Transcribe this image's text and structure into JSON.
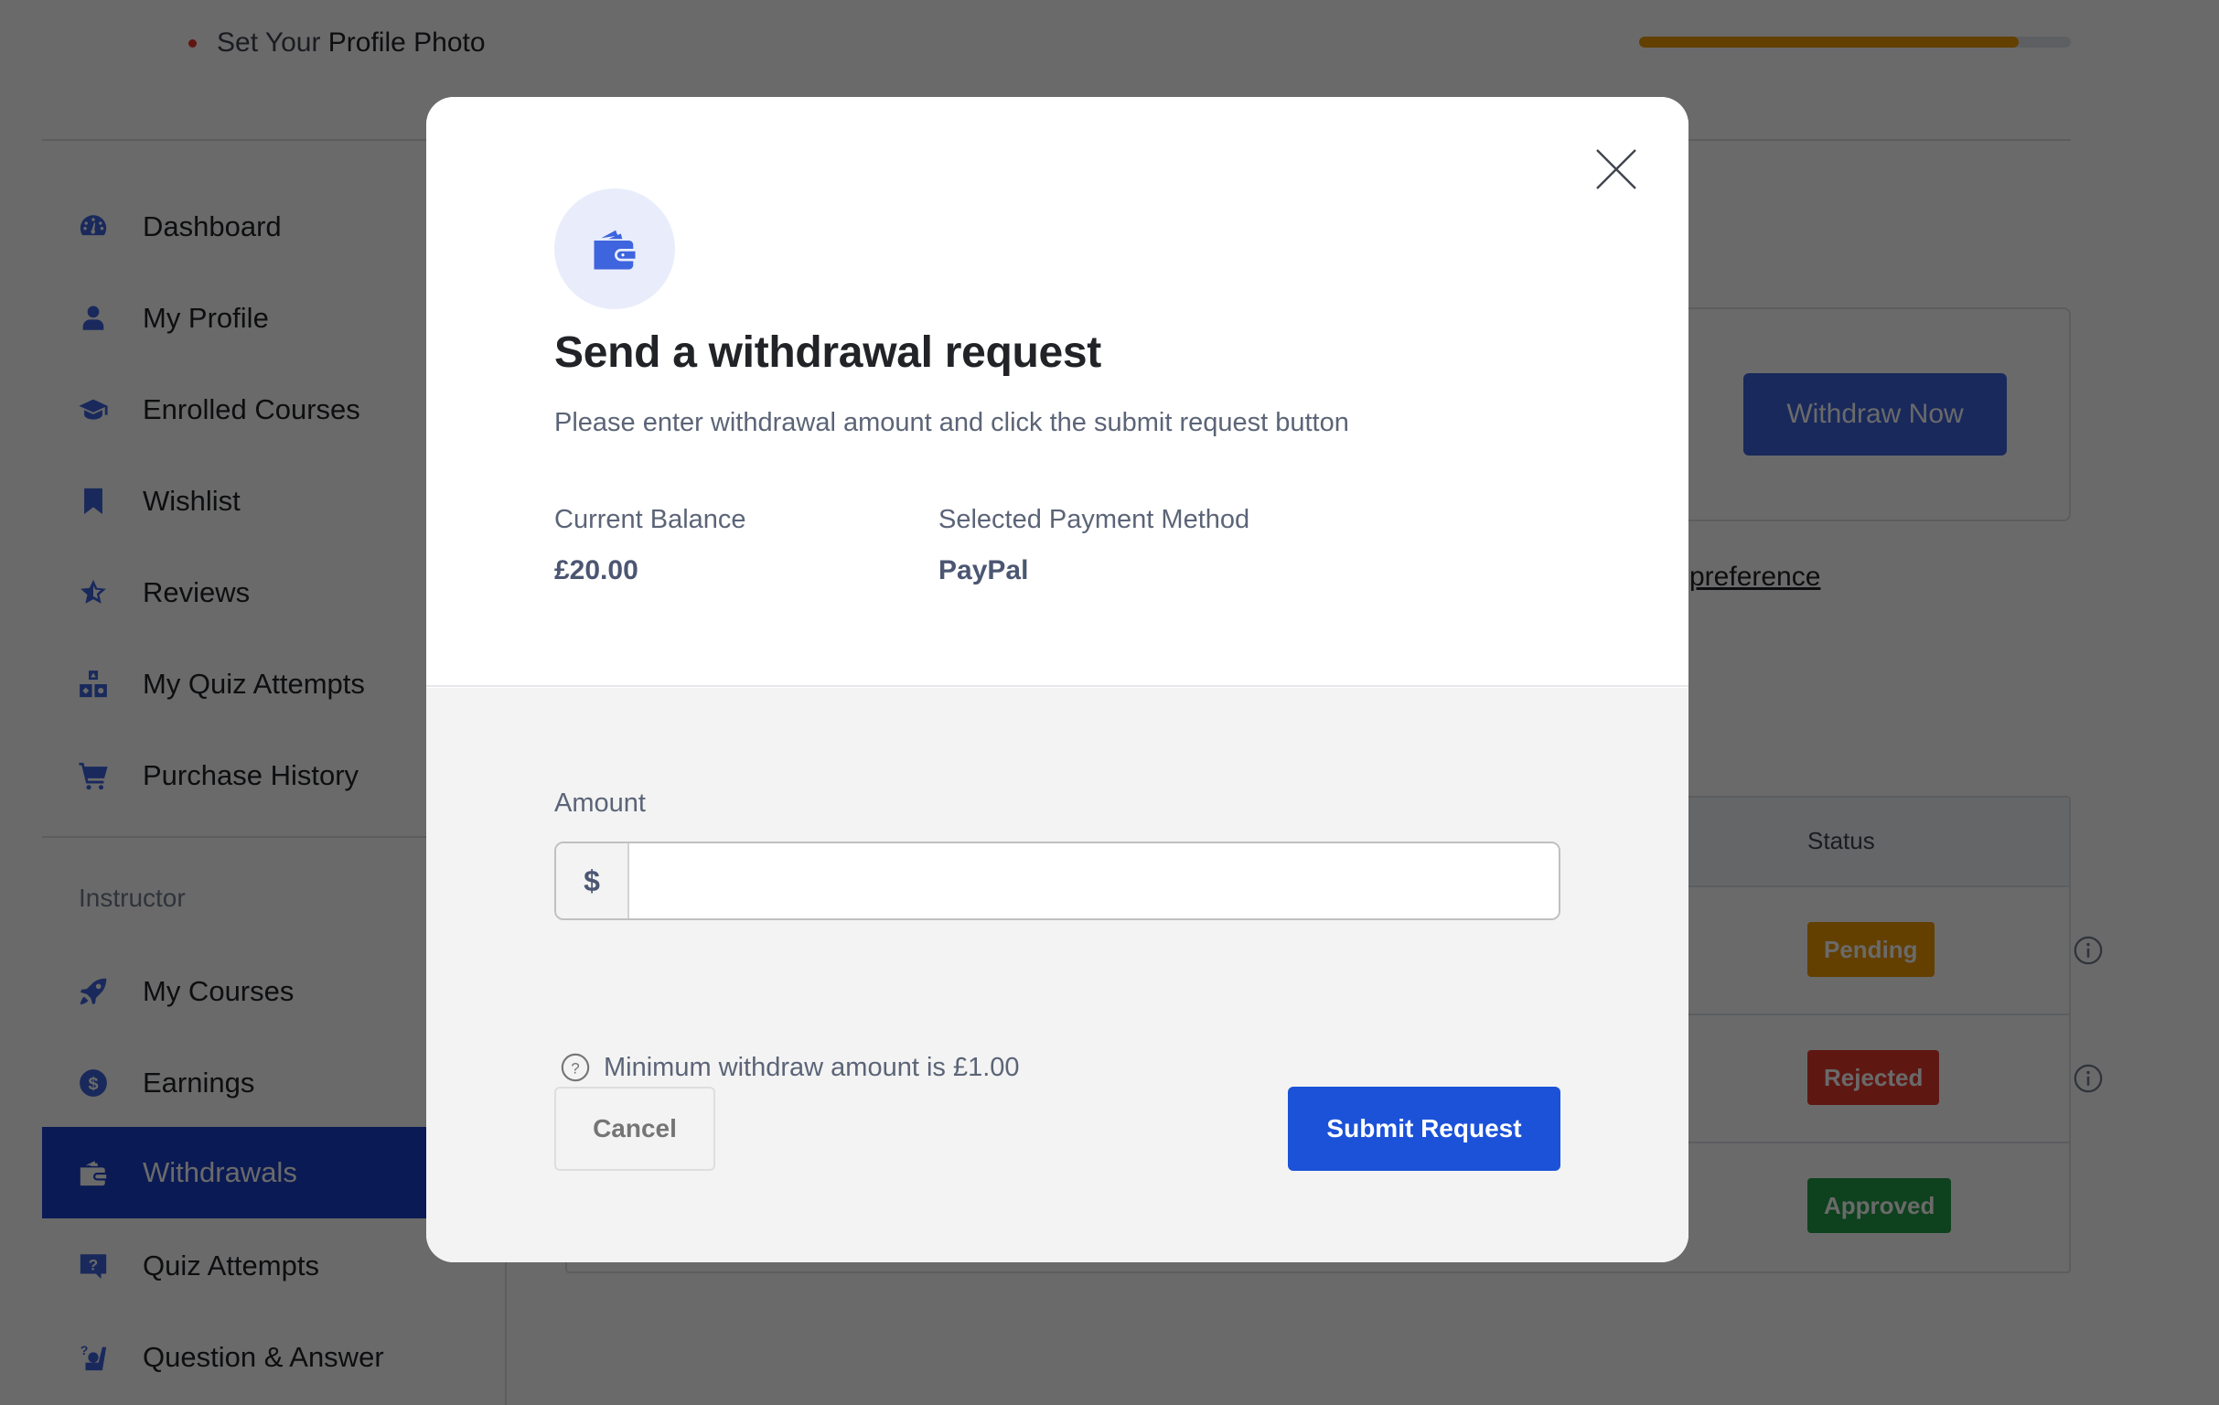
{
  "profile_todo": {
    "prefix": "Set Your",
    "strong": "Profile Photo",
    "progress_percent": 88,
    "progress_color": "#ED9700"
  },
  "sidebar": {
    "student_items": [
      {
        "label": "Dashboard",
        "icon": "dashboard-gauge-icon"
      },
      {
        "label": "My Profile",
        "icon": "user-icon"
      },
      {
        "label": "Enrolled Courses",
        "icon": "graduation-cap-icon"
      },
      {
        "label": "Wishlist",
        "icon": "bookmark-icon"
      },
      {
        "label": "Reviews",
        "icon": "star-half-icon"
      },
      {
        "label": "My Quiz Attempts",
        "icon": "quiz-blocks-icon"
      },
      {
        "label": "Purchase History",
        "icon": "cart-icon"
      }
    ],
    "instructor_section_title": "Instructor",
    "instructor_items": [
      {
        "label": "My Courses",
        "icon": "rocket-icon"
      },
      {
        "label": "Earnings",
        "icon": "dollar-badge-icon"
      },
      {
        "label": "Withdrawals",
        "icon": "wallet-icon",
        "active": true
      },
      {
        "label": "Quiz Attempts",
        "icon": "question-chat-icon"
      },
      {
        "label": "Question & Answer",
        "icon": "question-answer-icon"
      }
    ],
    "active_color": "#1a3fc9"
  },
  "content": {
    "withdraw_now_label": "Withdraw Now",
    "preference_link_text": "l preference",
    "table": {
      "status_header": "Status",
      "rows": [
        {
          "status": "Pending",
          "color": "#ED9700",
          "has_info": true
        },
        {
          "status": "Rejected",
          "color": "#E4382D",
          "has_info": true
        },
        {
          "status": "Approved",
          "color": "#239C46",
          "has_info": false
        }
      ]
    }
  },
  "modal": {
    "title": "Send a withdrawal request",
    "subtitle": "Please enter withdrawal amount and click the submit request button",
    "balance_label": "Current Balance",
    "balance_value": "£20.00",
    "method_label": "Selected Payment Method",
    "method_value": "PayPal",
    "amount_label": "Amount",
    "currency_symbol": "$",
    "amount_value": "",
    "amount_placeholder": "",
    "min_hint": "Minimum withdraw amount is £1.00",
    "cancel_label": "Cancel",
    "submit_label": "Submit Request",
    "submit_color": "#1b52d8"
  }
}
